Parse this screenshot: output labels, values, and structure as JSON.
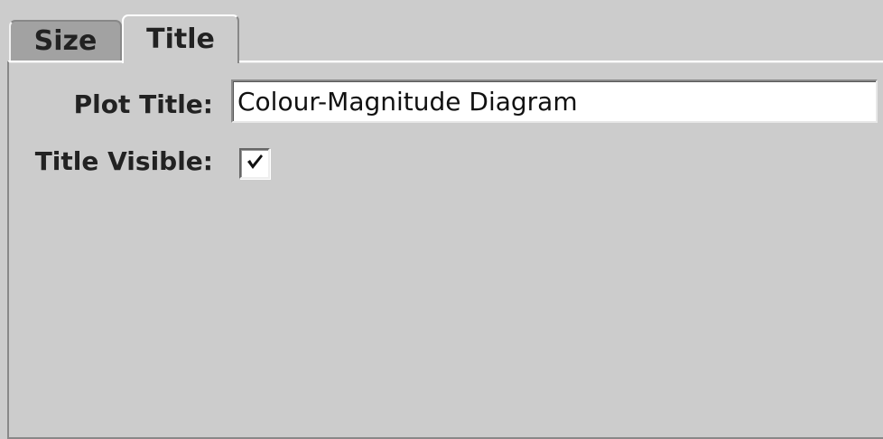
{
  "tabs": [
    {
      "label": "Size",
      "selected": false
    },
    {
      "label": "Title",
      "selected": true
    }
  ],
  "form": {
    "plot_title_label": "Plot Title:",
    "plot_title_value": "Colour-Magnitude Diagram",
    "title_visible_label": "Title Visible:",
    "title_visible_checked": true
  },
  "icons": {
    "checkbox_mark": "checkmark-icon"
  }
}
